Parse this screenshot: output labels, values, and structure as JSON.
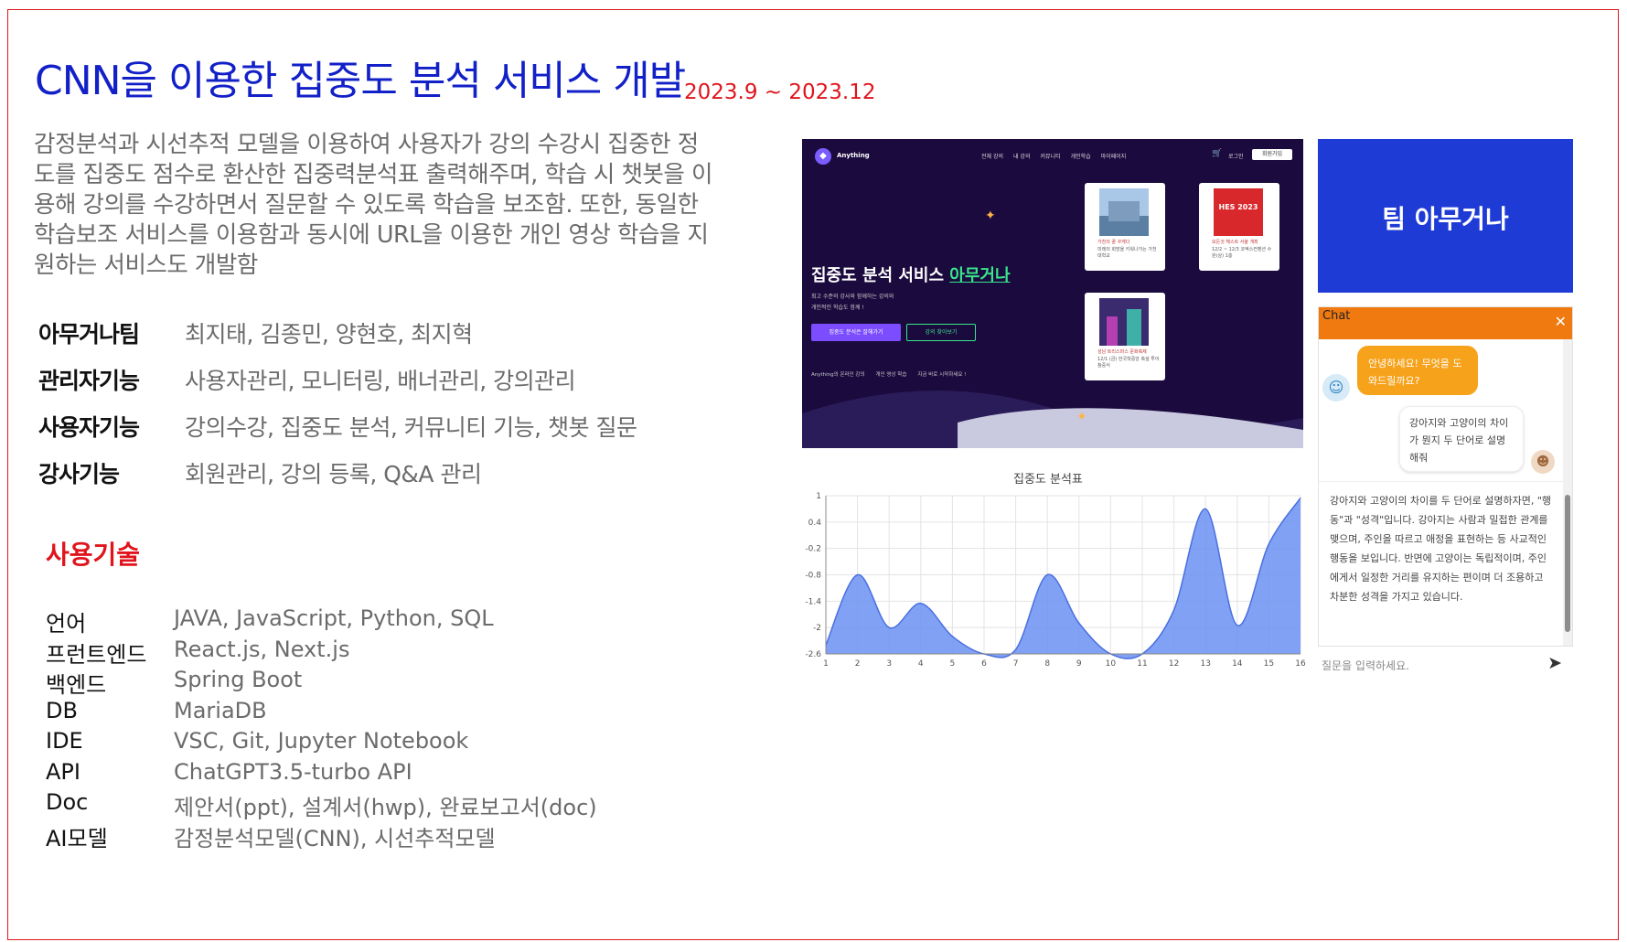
{
  "title": "CNN을 이용한 집중도 분석 서비스 개발",
  "period": "2023.9 ~ 2023.12",
  "description_lines": [
    "감정분석과 시선추적 모델을 이용하여 사용자가 강의 수강시 집중한 정",
    "도를 집중도 점수로 환산한 집중력분석표 출력해주며, 학습 시 챗봇을 이",
    "용해 강의를 수강하면서 질문할 수 있도록 학습을 보조함. 또한, 동일한",
    "학습보조 서비스를 이용함과 동시에 URL을 이용한 개인 영상 학습을 지",
    "원하는 서비스도 개발함"
  ],
  "info": [
    {
      "label": "아무거나팀",
      "value": "최지태, 김종민, 양현호, 최지혁"
    },
    {
      "label": "관리자기능",
      "value": "사용자관리, 모니터링, 배너관리, 강의관리"
    },
    {
      "label": "사용자기능",
      "value": "강의수강, 집중도 분석, 커뮤니티 기능, 챗봇 질문"
    },
    {
      "label": "강사기능",
      "value": "회원관리, 강의 등록, Q&A 관리"
    }
  ],
  "tech_title": "사용기술",
  "tech": [
    {
      "label": "언어",
      "value": "JAVA, JavaScript, Python, SQL"
    },
    {
      "label": "프런트엔드",
      "value": "React.js, Next.js"
    },
    {
      "label": "백엔드",
      "value": "Spring Boot"
    },
    {
      "label": "DB",
      "value": "MariaDB"
    },
    {
      "label": "IDE",
      "value": "VSC, Git, Jupyter Notebook"
    },
    {
      "label": "API",
      "value": "ChatGPT3.5-turbo API"
    },
    {
      "label": "Doc",
      "value": "제안서(ppt), 설계서(hwp), 완료보고서(doc)"
    },
    {
      "label": "AI모델",
      "value": "감정분석모델(CNN), 시선추적모델"
    }
  ],
  "site": {
    "brand": "Anything",
    "nav": [
      "전체 강의",
      "내 강의",
      "커뮤니티",
      "개인학습",
      "마이페이지"
    ],
    "login": "로그인",
    "signup": "회원가입",
    "hero_title_prefix": "집중도 분석 서비스 ",
    "hero_title_highlight": "아무거나",
    "hero_sub_1": "최고 수준의 강사와 함께하는 강의와",
    "hero_sub_2": "개인적인 학습도 함께 !",
    "btn_primary": "집중도 분석은 잘해가기",
    "btn_secondary": "강의 찾아보기",
    "features": [
      "Anything의 온라인 강의",
      "개인 영상 학습",
      "지금 바로 시작하세요 !"
    ],
    "cards": [
      {
        "caption": "가천의 꿈 꾸게다",
        "sub": "미래의 희망을 키워나가는 가천대학교"
      },
      {
        "caption": "모든것 헤스트 서울 개최",
        "sub": "12/2 ~ 12/3 코엑스컨벤션 수원(상) 1층"
      },
      {
        "caption": "성남 트리스마스 문화축제",
        "sub": "12/1 (금) 한국학중앙 축설 투어 참중식"
      }
    ],
    "card_badge": "HES 2023"
  },
  "chart_data": {
    "type": "area",
    "title": "집중도 분석표",
    "x": [
      1,
      2,
      3,
      4,
      5,
      6,
      7,
      8,
      9,
      10,
      11,
      12,
      13,
      14,
      15,
      16
    ],
    "values": [
      -2.4,
      -0.8,
      -2.0,
      -1.45,
      -2.2,
      -2.6,
      -2.5,
      -0.8,
      -1.9,
      -2.6,
      -2.6,
      -1.6,
      0.7,
      -1.95,
      -0.1,
      0.95
    ],
    "y_ticks": [
      "1",
      "0.4",
      "-0.2",
      "-0.8",
      "-1.4",
      "-2",
      "-2.6"
    ],
    "x_ticks": [
      "1",
      "2",
      "3",
      "4",
      "5",
      "6",
      "7",
      "8",
      "9",
      "10",
      "11",
      "12",
      "13",
      "14",
      "15",
      "16"
    ],
    "ylim": [
      -2.6,
      1
    ],
    "xlim": [
      1,
      16
    ],
    "grid": true,
    "fill_color": "#6b90f2",
    "line_color": "#4a6fe0"
  },
  "team_label": "팀 아무거나",
  "chat": {
    "title": "Chat",
    "close": "✕",
    "bot_message": "안녕하세요! 무엇을 도와드릴까요?",
    "user_message": "강아지와 고양이의 차이가 뭔지 두 단어로 설명해줘",
    "answer": "강아지와 고양이의 차이를 두 단어로 설명하자면, \"행동\"과 \"성격\"입니다. 강아지는 사람과 밀접한 관계를 맺으며, 주인을 따르고 애정을 표현하는 등 사교적인 행동을 보입니다. 반면에 고양이는 독립적이며, 주인에게서 일정한 거리를 유지하는 편이며 더 조용하고 차분한 성격을 가지고 있습니다.",
    "placeholder": "질문을 입력하세요.",
    "send_icon": "send-icon"
  },
  "colors": {
    "accent_red": "#e0141c",
    "title_blue": "#1220c8",
    "team_blue": "#1f3bd6",
    "chat_orange": "#f07a10"
  }
}
